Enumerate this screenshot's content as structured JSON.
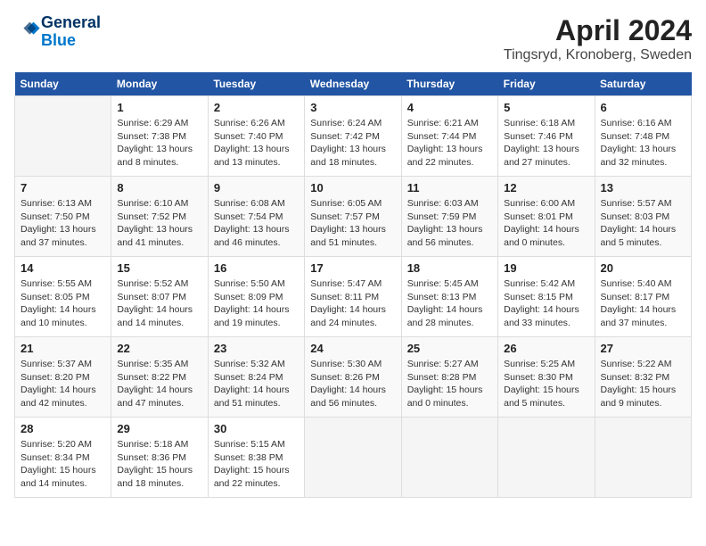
{
  "header": {
    "logo_line1": "General",
    "logo_line2": "Blue",
    "month": "April 2024",
    "location": "Tingsryd, Kronoberg, Sweden"
  },
  "weekdays": [
    "Sunday",
    "Monday",
    "Tuesday",
    "Wednesday",
    "Thursday",
    "Friday",
    "Saturday"
  ],
  "weeks": [
    [
      {
        "day": "",
        "info": ""
      },
      {
        "day": "1",
        "info": "Sunrise: 6:29 AM\nSunset: 7:38 PM\nDaylight: 13 hours\nand 8 minutes."
      },
      {
        "day": "2",
        "info": "Sunrise: 6:26 AM\nSunset: 7:40 PM\nDaylight: 13 hours\nand 13 minutes."
      },
      {
        "day": "3",
        "info": "Sunrise: 6:24 AM\nSunset: 7:42 PM\nDaylight: 13 hours\nand 18 minutes."
      },
      {
        "day": "4",
        "info": "Sunrise: 6:21 AM\nSunset: 7:44 PM\nDaylight: 13 hours\nand 22 minutes."
      },
      {
        "day": "5",
        "info": "Sunrise: 6:18 AM\nSunset: 7:46 PM\nDaylight: 13 hours\nand 27 minutes."
      },
      {
        "day": "6",
        "info": "Sunrise: 6:16 AM\nSunset: 7:48 PM\nDaylight: 13 hours\nand 32 minutes."
      }
    ],
    [
      {
        "day": "7",
        "info": "Sunrise: 6:13 AM\nSunset: 7:50 PM\nDaylight: 13 hours\nand 37 minutes."
      },
      {
        "day": "8",
        "info": "Sunrise: 6:10 AM\nSunset: 7:52 PM\nDaylight: 13 hours\nand 41 minutes."
      },
      {
        "day": "9",
        "info": "Sunrise: 6:08 AM\nSunset: 7:54 PM\nDaylight: 13 hours\nand 46 minutes."
      },
      {
        "day": "10",
        "info": "Sunrise: 6:05 AM\nSunset: 7:57 PM\nDaylight: 13 hours\nand 51 minutes."
      },
      {
        "day": "11",
        "info": "Sunrise: 6:03 AM\nSunset: 7:59 PM\nDaylight: 13 hours\nand 56 minutes."
      },
      {
        "day": "12",
        "info": "Sunrise: 6:00 AM\nSunset: 8:01 PM\nDaylight: 14 hours\nand 0 minutes."
      },
      {
        "day": "13",
        "info": "Sunrise: 5:57 AM\nSunset: 8:03 PM\nDaylight: 14 hours\nand 5 minutes."
      }
    ],
    [
      {
        "day": "14",
        "info": "Sunrise: 5:55 AM\nSunset: 8:05 PM\nDaylight: 14 hours\nand 10 minutes."
      },
      {
        "day": "15",
        "info": "Sunrise: 5:52 AM\nSunset: 8:07 PM\nDaylight: 14 hours\nand 14 minutes."
      },
      {
        "day": "16",
        "info": "Sunrise: 5:50 AM\nSunset: 8:09 PM\nDaylight: 14 hours\nand 19 minutes."
      },
      {
        "day": "17",
        "info": "Sunrise: 5:47 AM\nSunset: 8:11 PM\nDaylight: 14 hours\nand 24 minutes."
      },
      {
        "day": "18",
        "info": "Sunrise: 5:45 AM\nSunset: 8:13 PM\nDaylight: 14 hours\nand 28 minutes."
      },
      {
        "day": "19",
        "info": "Sunrise: 5:42 AM\nSunset: 8:15 PM\nDaylight: 14 hours\nand 33 minutes."
      },
      {
        "day": "20",
        "info": "Sunrise: 5:40 AM\nSunset: 8:17 PM\nDaylight: 14 hours\nand 37 minutes."
      }
    ],
    [
      {
        "day": "21",
        "info": "Sunrise: 5:37 AM\nSunset: 8:20 PM\nDaylight: 14 hours\nand 42 minutes."
      },
      {
        "day": "22",
        "info": "Sunrise: 5:35 AM\nSunset: 8:22 PM\nDaylight: 14 hours\nand 47 minutes."
      },
      {
        "day": "23",
        "info": "Sunrise: 5:32 AM\nSunset: 8:24 PM\nDaylight: 14 hours\nand 51 minutes."
      },
      {
        "day": "24",
        "info": "Sunrise: 5:30 AM\nSunset: 8:26 PM\nDaylight: 14 hours\nand 56 minutes."
      },
      {
        "day": "25",
        "info": "Sunrise: 5:27 AM\nSunset: 8:28 PM\nDaylight: 15 hours\nand 0 minutes."
      },
      {
        "day": "26",
        "info": "Sunrise: 5:25 AM\nSunset: 8:30 PM\nDaylight: 15 hours\nand 5 minutes."
      },
      {
        "day": "27",
        "info": "Sunrise: 5:22 AM\nSunset: 8:32 PM\nDaylight: 15 hours\nand 9 minutes."
      }
    ],
    [
      {
        "day": "28",
        "info": "Sunrise: 5:20 AM\nSunset: 8:34 PM\nDaylight: 15 hours\nand 14 minutes."
      },
      {
        "day": "29",
        "info": "Sunrise: 5:18 AM\nSunset: 8:36 PM\nDaylight: 15 hours\nand 18 minutes."
      },
      {
        "day": "30",
        "info": "Sunrise: 5:15 AM\nSunset: 8:38 PM\nDaylight: 15 hours\nand 22 minutes."
      },
      {
        "day": "",
        "info": ""
      },
      {
        "day": "",
        "info": ""
      },
      {
        "day": "",
        "info": ""
      },
      {
        "day": "",
        "info": ""
      }
    ]
  ]
}
